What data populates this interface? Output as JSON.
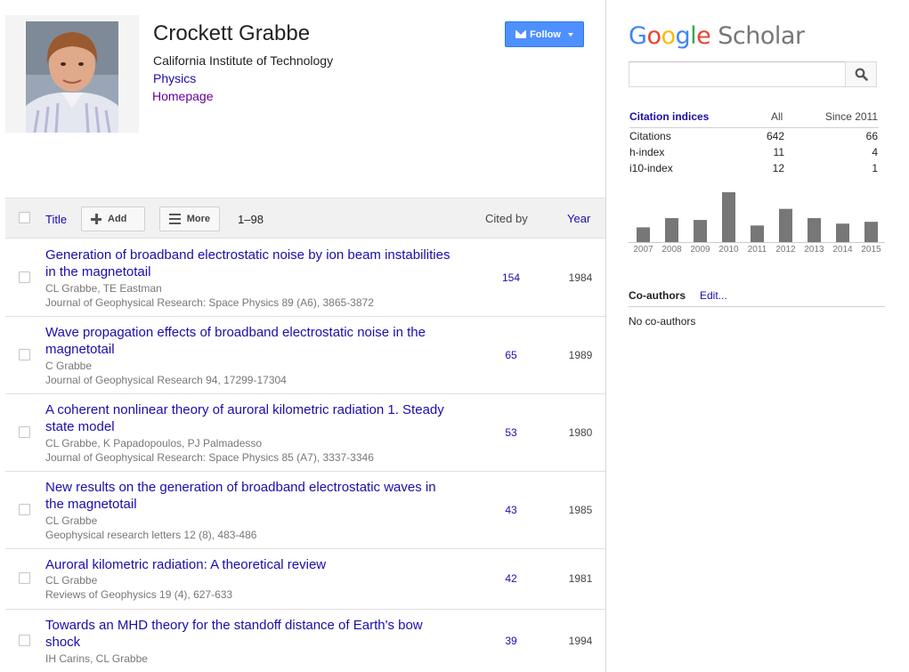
{
  "profile": {
    "name": "Crockett Grabbe",
    "affiliation": "California Institute of Technology",
    "field": "Physics",
    "homepage_label": "Homepage",
    "follow_label": "Follow"
  },
  "table": {
    "title_label": "Title",
    "add_label": "Add",
    "more_label": "More",
    "range": "1–98",
    "cited_by_label": "Cited by",
    "year_label": "Year",
    "rows": [
      {
        "title": "Generation of broadband electrostatic noise by ion beam instabilities in the magnetotail",
        "authors": "CL Grabbe, TE Eastman",
        "venue": "Journal of Geophysical Research: Space Physics 89 (A6), 3865-3872",
        "cited": "154",
        "year": "1984"
      },
      {
        "title": "Wave propagation effects of broadband electrostatic noise in the magnetotail",
        "authors": "C Grabbe",
        "venue": "Journal of Geophysical Research 94, 17299-17304",
        "cited": "65",
        "year": "1989"
      },
      {
        "title": "A coherent nonlinear theory of auroral kilometric radiation 1. Steady state model",
        "authors": "CL Grabbe, K Papadopoulos, PJ Palmadesso",
        "venue": "Journal of Geophysical Research: Space Physics 85 (A7), 3337-3346",
        "cited": "53",
        "year": "1980"
      },
      {
        "title": "New results on the generation of broadband electrostatic waves in the magnetotail",
        "authors": "CL Grabbe",
        "venue": "Geophysical research letters 12 (8), 483-486",
        "cited": "43",
        "year": "1985"
      },
      {
        "title": "Auroral kilometric radiation: A theoretical review",
        "authors": "CL Grabbe",
        "venue": "Reviews of Geophysics 19 (4), 627-633",
        "cited": "42",
        "year": "1981"
      },
      {
        "title": "Towards an MHD theory for the standoff distance of Earth's bow shock",
        "authors": "IH Carins, CL Grabbe",
        "venue": "",
        "cited": "39",
        "year": "1994"
      }
    ]
  },
  "sidebar": {
    "logo_google": "Google",
    "logo_scholar": "Scholar",
    "logo_colors": [
      "#4285f4",
      "#ea4335",
      "#fbbc05",
      "#4285f4",
      "#34a853",
      "#ea4335"
    ],
    "search_icon": "search-icon",
    "citation_label": "Citation indices",
    "col_all": "All",
    "col_since": "Since 2011",
    "indices": [
      {
        "name": "Citations",
        "all": "642",
        "since": "66"
      },
      {
        "name": "h-index",
        "all": "11",
        "since": "4"
      },
      {
        "name": "i10-index",
        "all": "12",
        "since": "1"
      }
    ],
    "coauthors_label": "Co-authors",
    "coauthors_edit": "Edit...",
    "coauthors_none": "No co-authors"
  },
  "chart_data": {
    "type": "bar",
    "categories": [
      "2007",
      "2008",
      "2009",
      "2010",
      "2011",
      "2012",
      "2013",
      "2014",
      "2015"
    ],
    "values": [
      8,
      13,
      12,
      27,
      9,
      18,
      13,
      10,
      11
    ],
    "ylim": [
      0,
      27
    ],
    "grid": false,
    "bar_color": "#777777"
  }
}
